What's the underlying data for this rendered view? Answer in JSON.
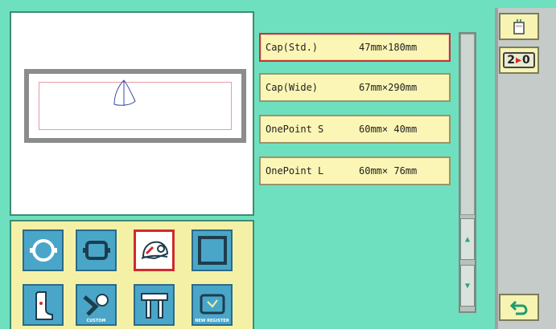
{
  "frame_list": [
    {
      "name": "Cap(Std.)",
      "size": "47mm×180mm",
      "selected": true
    },
    {
      "name": "Cap(Wide)",
      "size": "67mm×290mm",
      "selected": false
    },
    {
      "name": "OnePoint S",
      "size": "60mm× 40mm",
      "selected": false
    },
    {
      "name": "OnePoint L",
      "size": "60mm× 76mm",
      "selected": false
    }
  ],
  "frame_types": {
    "row1": [
      "round-hoop-icon",
      "square-hoop-icon",
      "cap-frame-icon",
      "large-square-hoop-icon"
    ],
    "row2": [
      "boot-frame-icon",
      "custom-frame-icon",
      "tubular-frame-icon",
      "new-register-frame-icon"
    ],
    "custom_label": "CUSTOM",
    "new_register_label": "NEW REGISTER"
  },
  "right_column": {
    "machine_icon": "machine-status-icon",
    "head_badge": {
      "left": "2",
      "right": "0"
    },
    "back_icon": "return-arrow-icon"
  },
  "colors": {
    "background": "#6fe0bf",
    "list_item_bg": "#fbf6b5",
    "selection_border": "#c0392b",
    "frame_panel_bg": "#f4f1a7"
  }
}
